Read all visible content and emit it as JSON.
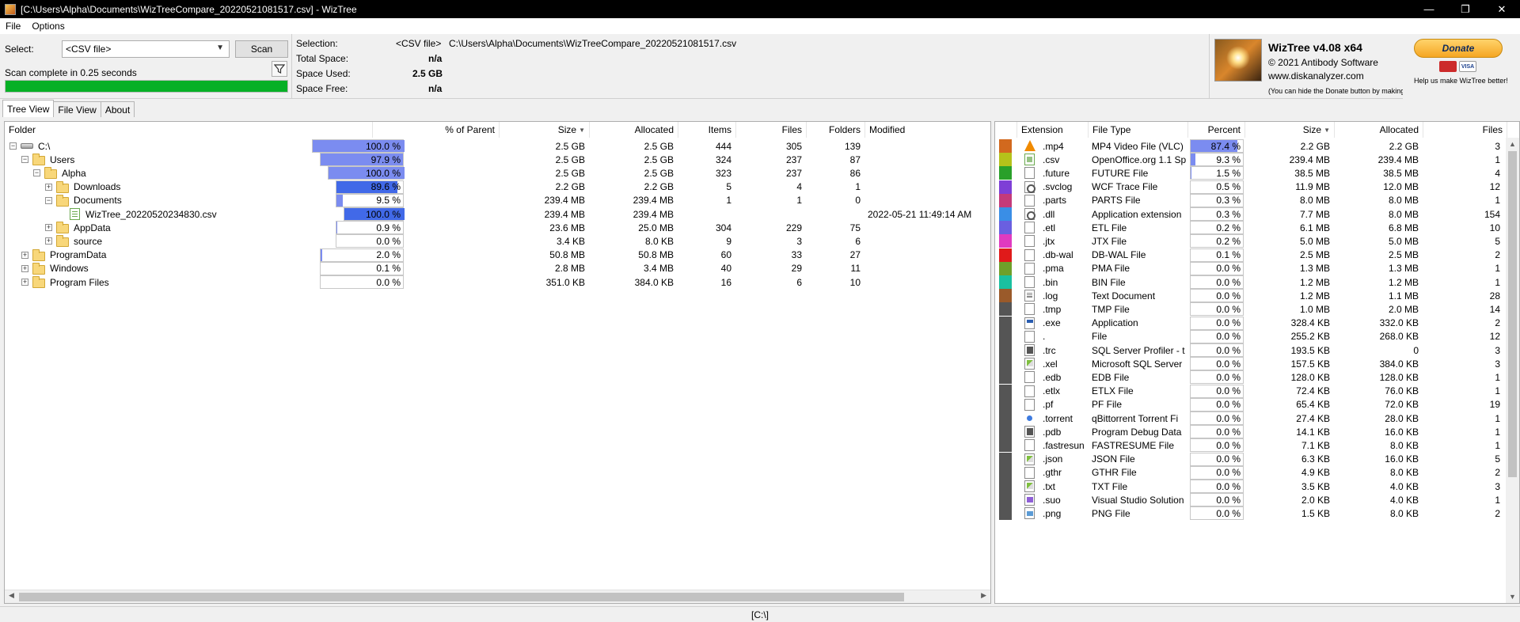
{
  "window": {
    "title": "[C:\\Users\\Alpha\\Documents\\WizTreeCompare_20220521081517.csv]  - WizTree",
    "minimize": "—",
    "maximize": "❐",
    "close": "✕"
  },
  "menu": {
    "file": "File",
    "options": "Options"
  },
  "top": {
    "select_label": "Select:",
    "select_value": "<CSV file>",
    "scan_button": "Scan",
    "scan_status": "Scan complete in 0.25 seconds",
    "progress_fraction": 1.0,
    "selection_label": "Selection:",
    "selection_value": "<CSV file>",
    "selection_path": "C:\\Users\\Alpha\\Documents\\WizTreeCompare_20220521081517.csv",
    "total_space_label": "Total Space:",
    "total_space_value": "n/a",
    "space_used_label": "Space Used:",
    "space_used_value": "2.5 GB",
    "space_free_label": "Space Free:",
    "space_free_value": "n/a"
  },
  "brand": {
    "name": "WizTree v4.08 x64",
    "copyright": "© 2021 Antibody Software",
    "url": "www.diskanalyzer.com",
    "hide_note": "(You can hide the Donate button by making a donation)",
    "donate_button": "Donate",
    "visa": "VISA",
    "donate_note": "Help us make WizTree better!"
  },
  "tabs": [
    "Tree View",
    "File View",
    "About"
  ],
  "tree": {
    "headers": {
      "folder": "Folder",
      "pct": "% of Parent",
      "size": "Size",
      "allocated": "Allocated",
      "items": "Items",
      "files": "Files",
      "folders": "Folders",
      "modified": "Modified"
    },
    "rows": [
      {
        "name": "C:\\",
        "pct": "100.0 %",
        "pct_value": 100.0,
        "size": "2.5 GB",
        "allocated": "2.5 GB",
        "items": "444",
        "files": "305",
        "folders": "139",
        "modified": ""
      },
      {
        "name": "Users",
        "pct": "97.9 %",
        "pct_value": 97.9,
        "size": "2.5 GB",
        "allocated": "2.5 GB",
        "items": "324",
        "files": "237",
        "folders": "87",
        "modified": ""
      },
      {
        "name": "Alpha",
        "pct": "100.0 %",
        "pct_value": 100.0,
        "size": "2.5 GB",
        "allocated": "2.5 GB",
        "items": "323",
        "files": "237",
        "folders": "86",
        "modified": ""
      },
      {
        "name": "Downloads",
        "pct": "89.6 %",
        "pct_value": 89.6,
        "size": "2.2 GB",
        "allocated": "2.2 GB",
        "items": "5",
        "files": "4",
        "folders": "1",
        "modified": ""
      },
      {
        "name": "Documents",
        "pct": "9.5 %",
        "pct_value": 9.5,
        "size": "239.4 MB",
        "allocated": "239.4 MB",
        "items": "1",
        "files": "1",
        "folders": "0",
        "modified": ""
      },
      {
        "name": "WizTree_20220520234830.csv",
        "pct": "100.0 %",
        "pct_value": 100.0,
        "size": "239.4 MB",
        "allocated": "239.4 MB",
        "items": "",
        "files": "",
        "folders": "",
        "modified": "2022-05-21 11:49:14 AM"
      },
      {
        "name": "AppData",
        "pct": "0.9 %",
        "pct_value": 0.9,
        "size": "23.6 MB",
        "allocated": "25.0 MB",
        "items": "304",
        "files": "229",
        "folders": "75",
        "modified": ""
      },
      {
        "name": "source",
        "pct": "0.0 %",
        "pct_value": 0.0,
        "size": "3.4 KB",
        "allocated": "8.0 KB",
        "items": "9",
        "files": "3",
        "folders": "6",
        "modified": ""
      },
      {
        "name": "ProgramData",
        "pct": "2.0 %",
        "pct_value": 2.0,
        "size": "50.8 MB",
        "allocated": "50.8 MB",
        "items": "60",
        "files": "33",
        "folders": "27",
        "modified": ""
      },
      {
        "name": "Windows",
        "pct": "0.1 %",
        "pct_value": 0.1,
        "size": "2.8 MB",
        "allocated": "3.4 MB",
        "items": "40",
        "files": "29",
        "folders": "11",
        "modified": ""
      },
      {
        "name": "Program Files",
        "pct": "0.0 %",
        "pct_value": 0.0,
        "size": "351.0 KB",
        "allocated": "384.0 KB",
        "items": "16",
        "files": "6",
        "folders": "10",
        "modified": ""
      }
    ]
  },
  "ext": {
    "headers": {
      "extension": "Extension",
      "file_type": "File Type",
      "percent": "Percent",
      "size": "Size",
      "allocated": "Allocated",
      "files": "Files"
    },
    "rows": [
      {
        "ext": ".mp4",
        "type": "MP4 Video File (VLC)",
        "pct": "87.4 %",
        "pct_value": 87.4,
        "size": "2.2 GB",
        "allocated": "2.2 GB",
        "files": "3",
        "color": "#d2691e",
        "icon": "vlc-icon"
      },
      {
        "ext": ".csv",
        "type": "OpenOffice.org 1.1 Sp",
        "pct": "9.3 %",
        "pct_value": 9.3,
        "size": "239.4 MB",
        "allocated": "239.4 MB",
        "files": "1",
        "color": "#b5c21a",
        "icon": "csv-icon"
      },
      {
        "ext": ".future",
        "type": "FUTURE File",
        "pct": "1.5 %",
        "pct_value": 1.5,
        "size": "38.5 MB",
        "allocated": "38.5 MB",
        "files": "4",
        "color": "#2aa02a",
        "icon": "file-icon"
      },
      {
        "ext": ".svclog",
        "type": "WCF Trace File",
        "pct": "0.5 %",
        "pct_value": 0.5,
        "size": "11.9 MB",
        "allocated": "12.0 MB",
        "files": "12",
        "color": "#7e3fd6",
        "icon": "gear-file-icon"
      },
      {
        "ext": ".parts",
        "type": "PARTS File",
        "pct": "0.3 %",
        "pct_value": 0.3,
        "size": "8.0 MB",
        "allocated": "8.0 MB",
        "files": "1",
        "color": "#c43a7a",
        "icon": "file-icon"
      },
      {
        "ext": ".dll",
        "type": "Application extension",
        "pct": "0.3 %",
        "pct_value": 0.3,
        "size": "7.7 MB",
        "allocated": "8.0 MB",
        "files": "154",
        "color": "#3a8ee6",
        "icon": "gear-file-icon"
      },
      {
        "ext": ".etl",
        "type": "ETL File",
        "pct": "0.2 %",
        "pct_value": 0.2,
        "size": "6.1 MB",
        "allocated": "6.8 MB",
        "files": "10",
        "color": "#6a5fe0",
        "icon": "file-icon"
      },
      {
        "ext": ".jtx",
        "type": "JTX File",
        "pct": "0.2 %",
        "pct_value": 0.2,
        "size": "5.0 MB",
        "allocated": "5.0 MB",
        "files": "5",
        "color": "#e03ac0",
        "icon": "file-icon"
      },
      {
        "ext": ".db-wal",
        "type": "DB-WAL File",
        "pct": "0.1 %",
        "pct_value": 0.1,
        "size": "2.5 MB",
        "allocated": "2.5 MB",
        "files": "2",
        "color": "#e01a1a",
        "icon": "file-icon"
      },
      {
        "ext": ".pma",
        "type": "PMA File",
        "pct": "0.0 %",
        "pct_value": 0.0,
        "size": "1.3 MB",
        "allocated": "1.3 MB",
        "files": "1",
        "color": "#6fa02a",
        "icon": "file-icon"
      },
      {
        "ext": ".bin",
        "type": "BIN File",
        "pct": "0.0 %",
        "pct_value": 0.0,
        "size": "1.2 MB",
        "allocated": "1.2 MB",
        "files": "1",
        "color": "#1ac0a0",
        "icon": "file-icon"
      },
      {
        "ext": ".log",
        "type": "Text Document",
        "pct": "0.0 %",
        "pct_value": 0.0,
        "size": "1.2 MB",
        "allocated": "1.1 MB",
        "files": "28",
        "color": "#9a5a2a",
        "icon": "text-file-icon"
      },
      {
        "ext": ".tmp",
        "type": "TMP File",
        "pct": "0.0 %",
        "pct_value": 0.0,
        "size": "1.0 MB",
        "allocated": "2.0 MB",
        "files": "14",
        "color": "#555555",
        "icon": "file-icon"
      },
      {
        "ext": ".exe",
        "type": "Application",
        "pct": "0.0 %",
        "pct_value": 0.0,
        "size": "328.4 KB",
        "allocated": "332.0 KB",
        "files": "2",
        "color": "#555555",
        "icon": "app-icon"
      },
      {
        "ext": ".",
        "type": "File",
        "pct": "0.0 %",
        "pct_value": 0.0,
        "size": "255.2 KB",
        "allocated": "268.0 KB",
        "files": "12",
        "color": "#555555",
        "icon": "file-icon"
      },
      {
        "ext": ".trc",
        "type": "SQL Server Profiler - t",
        "pct": "0.0 %",
        "pct_value": 0.0,
        "size": "193.5 KB",
        "allocated": "0",
        "files": "3",
        "color": "#555555",
        "icon": "profiler-icon"
      },
      {
        "ext": ".xel",
        "type": "Microsoft SQL Server",
        "pct": "0.0 %",
        "pct_value": 0.0,
        "size": "157.5 KB",
        "allocated": "384.0 KB",
        "files": "3",
        "color": "#555555",
        "icon": "edit-file-icon"
      },
      {
        "ext": ".edb",
        "type": "EDB File",
        "pct": "0.0 %",
        "pct_value": 0.0,
        "size": "128.0 KB",
        "allocated": "128.0 KB",
        "files": "1",
        "color": "#555555",
        "icon": "file-icon"
      },
      {
        "ext": ".etlx",
        "type": "ETLX File",
        "pct": "0.0 %",
        "pct_value": 0.0,
        "size": "72.4 KB",
        "allocated": "76.0 KB",
        "files": "1",
        "color": "#555555",
        "icon": "file-icon"
      },
      {
        "ext": ".pf",
        "type": "PF File",
        "pct": "0.0 %",
        "pct_value": 0.0,
        "size": "65.4 KB",
        "allocated": "72.0 KB",
        "files": "19",
        "color": "#555555",
        "icon": "file-icon"
      },
      {
        "ext": ".torrent",
        "type": "qBittorrent Torrent Fi",
        "pct": "0.0 %",
        "pct_value": 0.0,
        "size": "27.4 KB",
        "allocated": "28.0 KB",
        "files": "1",
        "color": "#555555",
        "icon": "torrent-icon"
      },
      {
        "ext": ".pdb",
        "type": "Program Debug Data",
        "pct": "0.0 %",
        "pct_value": 0.0,
        "size": "14.1 KB",
        "allocated": "16.0 KB",
        "files": "1",
        "color": "#555555",
        "icon": "debug-file-icon"
      },
      {
        "ext": ".fastresun",
        "type": "FASTRESUME File",
        "pct": "0.0 %",
        "pct_value": 0.0,
        "size": "7.1 KB",
        "allocated": "8.0 KB",
        "files": "1",
        "color": "#555555",
        "icon": "file-icon"
      },
      {
        "ext": ".json",
        "type": "JSON File",
        "pct": "0.0 %",
        "pct_value": 0.0,
        "size": "6.3 KB",
        "allocated": "16.0 KB",
        "files": "5",
        "color": "#555555",
        "icon": "edit-file-icon"
      },
      {
        "ext": ".gthr",
        "type": "GTHR File",
        "pct": "0.0 %",
        "pct_value": 0.0,
        "size": "4.9 KB",
        "allocated": "8.0 KB",
        "files": "2",
        "color": "#555555",
        "icon": "file-icon"
      },
      {
        "ext": ".txt",
        "type": "TXT File",
        "pct": "0.0 %",
        "pct_value": 0.0,
        "size": "3.5 KB",
        "allocated": "4.0 KB",
        "files": "3",
        "color": "#555555",
        "icon": "edit-file-icon"
      },
      {
        "ext": ".suo",
        "type": "Visual Studio Solution",
        "pct": "0.0 %",
        "pct_value": 0.0,
        "size": "2.0 KB",
        "allocated": "4.0 KB",
        "files": "1",
        "color": "#555555",
        "icon": "vs-file-icon"
      },
      {
        "ext": ".png",
        "type": "PNG File",
        "pct": "0.0 %",
        "pct_value": 0.0,
        "size": "1.5 KB",
        "allocated": "8.0 KB",
        "files": "2",
        "color": "#555555",
        "icon": "image-file-icon"
      }
    ]
  },
  "status": {
    "path": "[C:\\]"
  },
  "colors": {
    "bar_fill": "#7b8cf0",
    "bar_fill_strong": "#4169e8",
    "progress": "#06b025"
  }
}
